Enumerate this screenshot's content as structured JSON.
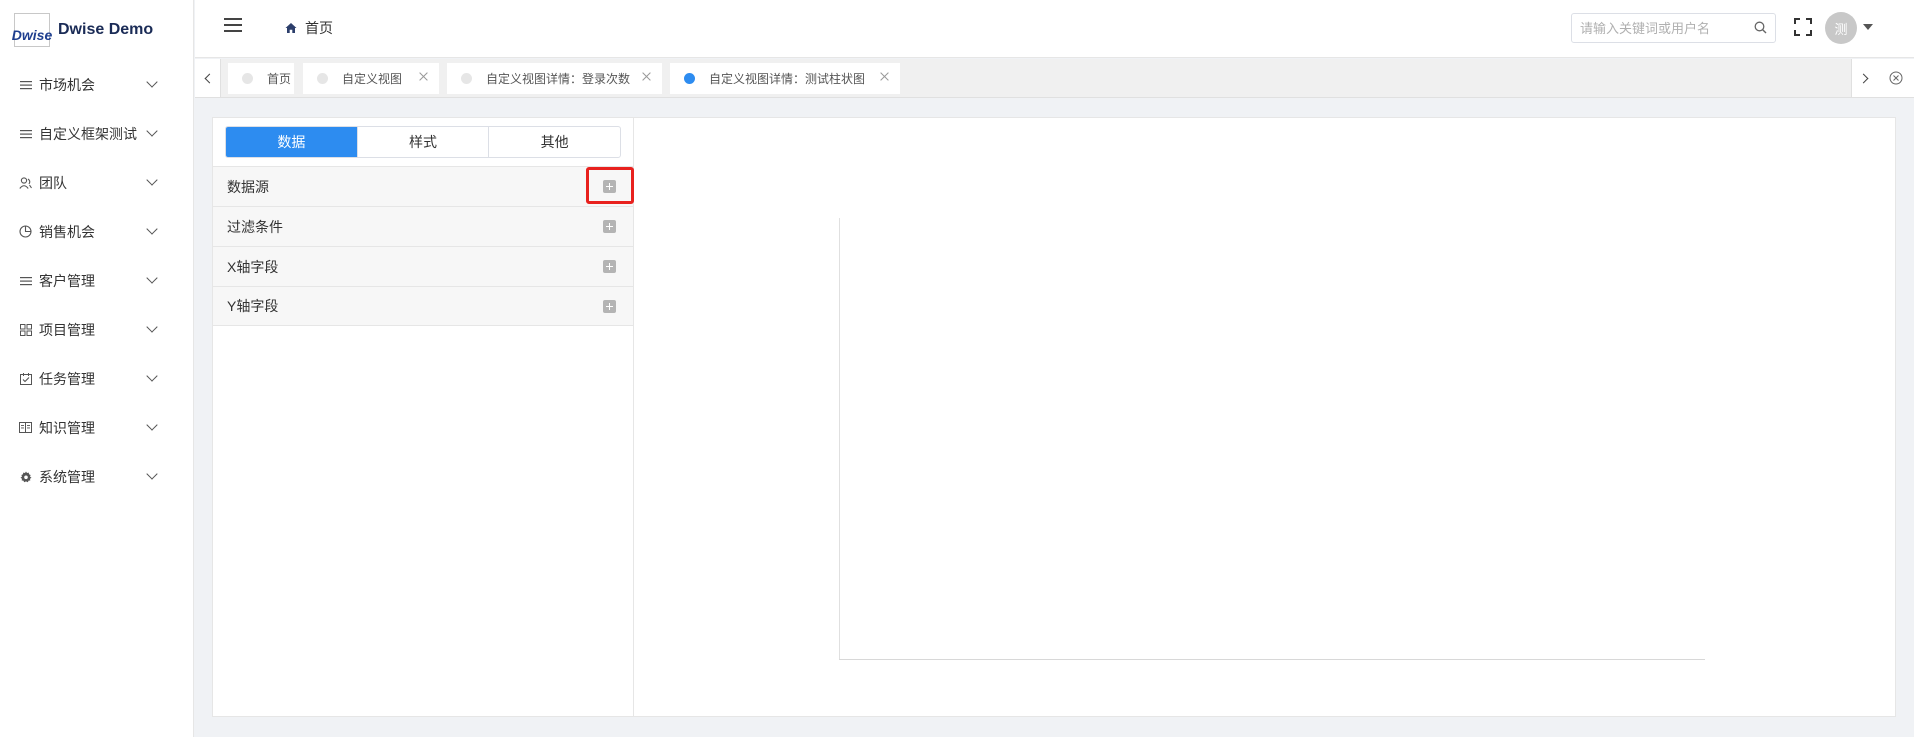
{
  "app": {
    "logo_text": "Dwise",
    "title": "Dwise Demo"
  },
  "sidebar": {
    "items": [
      {
        "label": "市场机会",
        "icon": "list-icon"
      },
      {
        "label": "自定义框架测试",
        "icon": "list-icon"
      },
      {
        "label": "团队",
        "icon": "team-icon"
      },
      {
        "label": "销售机会",
        "icon": "pie-icon"
      },
      {
        "label": "客户管理",
        "icon": "list-icon"
      },
      {
        "label": "项目管理",
        "icon": "grid-icon"
      },
      {
        "label": "任务管理",
        "icon": "calendar-check-icon"
      },
      {
        "label": "知识管理",
        "icon": "book-icon"
      },
      {
        "label": "系统管理",
        "icon": "gear-icon"
      }
    ]
  },
  "header": {
    "breadcrumb": "首页",
    "search_placeholder": "请输入关键词或用户名",
    "avatar_text": "测"
  },
  "tabs": [
    {
      "label": "首页",
      "active": false,
      "closable": false
    },
    {
      "label": "自定义视图",
      "active": false,
      "closable": true
    },
    {
      "label": "自定义视图详情：登录次数",
      "active": false,
      "closable": true
    },
    {
      "label": "自定义视图详情：测试柱状图",
      "active": true,
      "closable": true
    }
  ],
  "editor": {
    "segments": [
      "数据",
      "样式",
      "其他"
    ],
    "active_segment": 0,
    "fields": [
      "数据源",
      "过滤条件",
      "X轴字段",
      "Y轴字段"
    ]
  },
  "colors": {
    "accent": "#2d8cf0",
    "highlight": "#e8211e"
  }
}
